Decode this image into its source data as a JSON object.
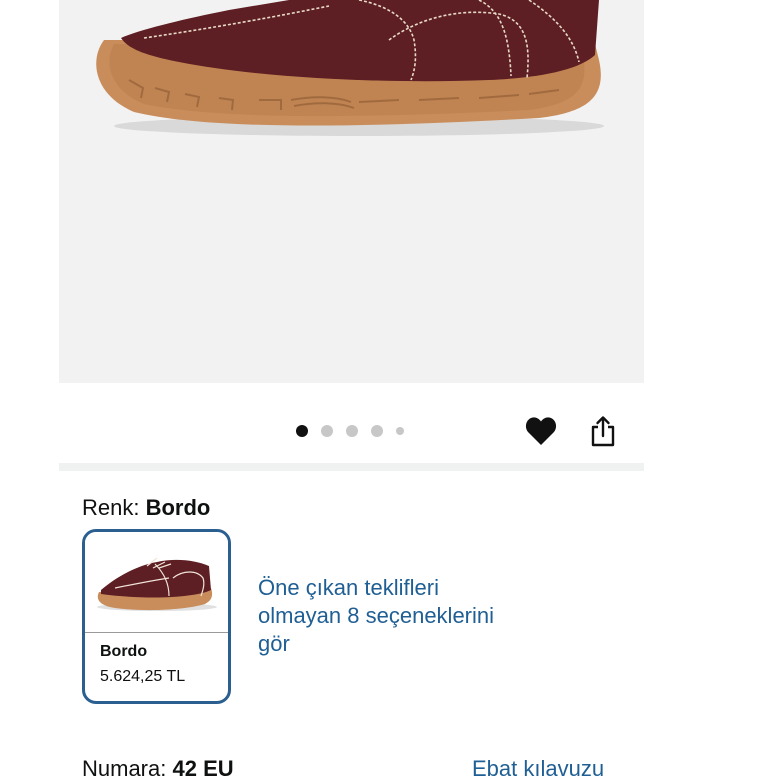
{
  "product_image": {
    "icon": "shoe-product-photo",
    "shoe_color": "#5e1f24",
    "sole_color": "#c98d5c"
  },
  "carousel": {
    "dot_count": 5,
    "active_index": 0
  },
  "actions": {
    "favorite_icon": "heart-icon",
    "share_icon": "share-icon"
  },
  "color_selector": {
    "label": "Renk:",
    "selected": "Bordo",
    "swatch": {
      "name": "Bordo",
      "price": "5.624,25 TL",
      "border_color": "#2b5f8f"
    }
  },
  "options_link": {
    "text": "Öne çıkan teklifleri olmayan 8 seçeneklerini gör"
  },
  "size_row": {
    "label": "Numara:",
    "selected": "42 EU",
    "guide_link": "Ebat kılavuzu"
  },
  "colors": {
    "link": "#1f5f94",
    "text": "#0f1111",
    "image_bg": "#f2f2f2"
  }
}
